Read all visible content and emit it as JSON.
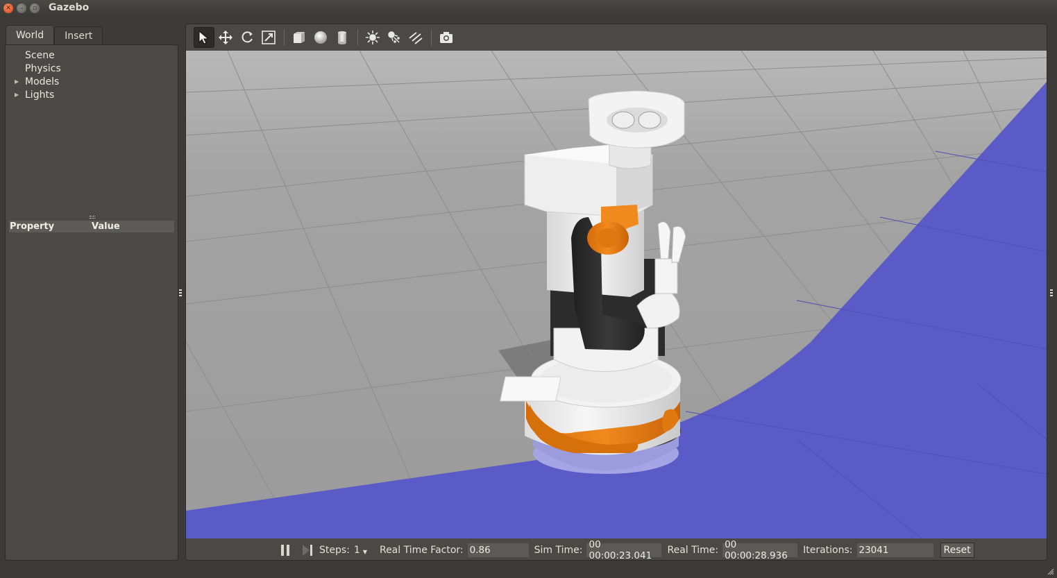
{
  "window": {
    "title": "Gazebo"
  },
  "tabs": [
    {
      "label": "World",
      "active": true
    },
    {
      "label": "Insert",
      "active": false
    }
  ],
  "world_tree": [
    {
      "label": "Scene",
      "expandable": false
    },
    {
      "label": "Physics",
      "expandable": false
    },
    {
      "label": "Models",
      "expandable": true
    },
    {
      "label": "Lights",
      "expandable": true
    }
  ],
  "property_table": {
    "col_property": "Property",
    "col_value": "Value"
  },
  "toolbar": {
    "tools": [
      {
        "name": "select-mode-icon",
        "active": true
      },
      {
        "name": "translate-mode-icon",
        "active": false
      },
      {
        "name": "rotate-mode-icon",
        "active": false
      },
      {
        "name": "scale-mode-icon",
        "active": false
      },
      {
        "name": "box-shape-icon",
        "active": false
      },
      {
        "name": "sphere-shape-icon",
        "active": false
      },
      {
        "name": "cylinder-shape-icon",
        "active": false
      },
      {
        "name": "point-light-icon",
        "active": false
      },
      {
        "name": "spot-light-icon",
        "active": false
      },
      {
        "name": "directional-light-icon",
        "active": false
      },
      {
        "name": "screenshot-icon",
        "active": false
      }
    ]
  },
  "status": {
    "steps_label": "Steps:",
    "steps_value": "1",
    "rtf_label": "Real Time Factor:",
    "rtf_value": "0.86",
    "sim_time_label": "Sim Time:",
    "sim_time_value": "00 00:00:23.041",
    "real_time_label": "Real Time:",
    "real_time_value": "00 00:00:28.936",
    "iterations_label": "Iterations:",
    "iterations_value": "23041",
    "reset_label": "Reset"
  },
  "colors": {
    "ground": "#a0a0a0",
    "floor_overlay": "#5b5bc7",
    "robot_orange": "#e57a12",
    "robot_white": "#f2f2f2",
    "robot_dark": "#2a2a2a"
  }
}
